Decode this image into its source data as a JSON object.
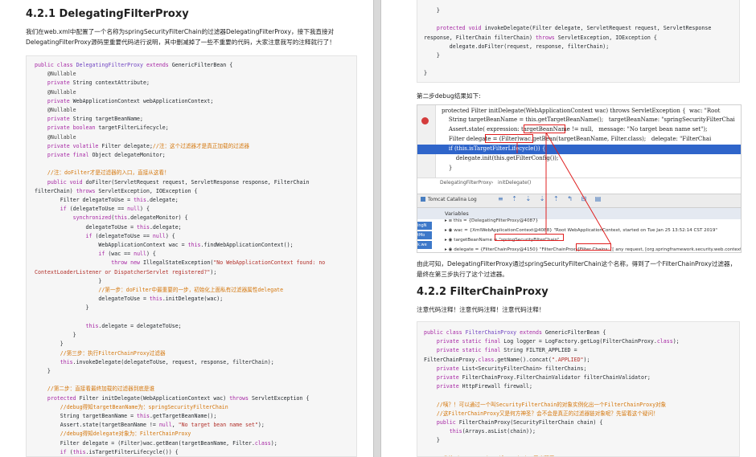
{
  "left": {
    "heading": "4.2.1 DelegatingFilterProxy",
    "para_line1": "我们在web.xml中配置了一个名称为springSecurityFilterChain的过滤器DelegatingFilterProxy，接下我直接对",
    "para_line2": "DelegatingFilterProxy源码里重要代码进行说明，其中删减掉了一些不重要的代码，大家注意我写的注释就行了！"
  },
  "right": {
    "caption_debug": "第二步debug结果如下:",
    "para_line1": "由此可知，DelegatingFilterProxy通过springSecurityFilterChain这个名称，得到了一个FilterChainProxy过滤器，",
    "para_line2": "最终在第三步执行了这个过滤器。",
    "heading": "4.2.2 FilterChainProxy",
    "note": "注意代码注释！注意代码注释！注意代码注释！"
  },
  "ide": {
    "crumb_class": "DelegatingFilterProxy",
    "crumb_sep": "›",
    "crumb_method": "initDelegate()",
    "toolbar_title": "Tomcat Catalina Log",
    "variables_label": "Variables",
    "lines": [
      "protected Filter initDelegate(WebApplicationContext wac) throws ServletException {  wac: \"Root",
      "    String targetBeanName = this.getTargetBeanName();   targetBeanName: \"springSecurityFilterChai",
      "    Assert.state( expression: targetBeanName != null,   message: \"No target bean name set\");",
      "    Filter delegate = (Filter)wac.getBean(targetBeanName, Filter.class);   delegate: \"FilterChai",
      "    if (this.isTargetFilterLifecycle()) {",
      "        delegate.init(this.getFilterConfig());",
      "    }"
    ],
    "vars": [
      "▸ ≡ this = {DelegatingFilterProxy@4087}",
      "▸ ◉ wac = {XmlWebApplicationContext@4088} \"Root WebApplicationContext, started on Tue Jan 25 13:52:14 CST 2019\"",
      "▸ ◉ targetBeanName = \"springSecurityFilterChain\"",
      "▸ ◉ delegate = {FilterChainProxy@4150} \"FilterChainProxy[Filter Chains: [[ any request, [org.springframework.security.web.context.Se"
    ],
    "side_tags": [
      "ingN",
      "tMo",
      "k.we"
    ]
  },
  "colors": {
    "keyword": "#a626a4",
    "comment": "#d4760b",
    "string": "#b2302a",
    "highlight": "#2f65ca",
    "redbox": "#e02020"
  }
}
